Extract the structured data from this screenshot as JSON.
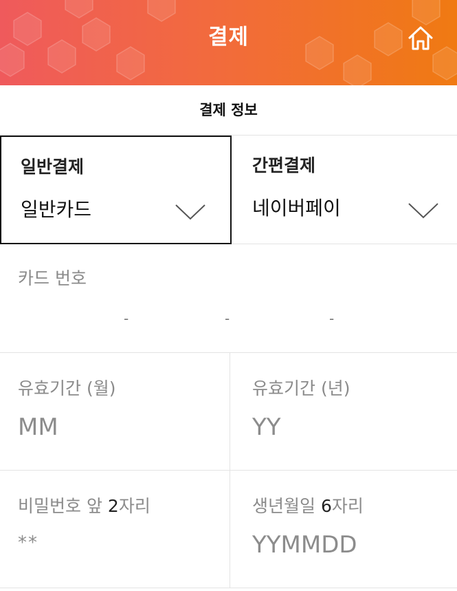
{
  "header": {
    "title": "결제",
    "home_icon": "home-icon",
    "gradient": [
      "#ef5a5c",
      "#f07a12"
    ]
  },
  "section": {
    "title": "결제 정보"
  },
  "payment": {
    "general": {
      "label": "일반결제",
      "selected": "일반카드"
    },
    "easy": {
      "label": "간편결제",
      "selected": "네이버페이"
    }
  },
  "card_number": {
    "label": "카드 번호",
    "separator": "-"
  },
  "expiry": {
    "month": {
      "label": "유효기간 (월)",
      "placeholder": "MM"
    },
    "year": {
      "label": "유효기간 (년)",
      "placeholder": "YY"
    }
  },
  "password": {
    "label_prefix": "비밀번호 앞 ",
    "label_num": "2",
    "label_suffix": "자리",
    "value": "**"
  },
  "birth": {
    "label_prefix": "생년월일 ",
    "label_num": "6",
    "label_suffix": "자리",
    "placeholder": "YYMMDD"
  }
}
